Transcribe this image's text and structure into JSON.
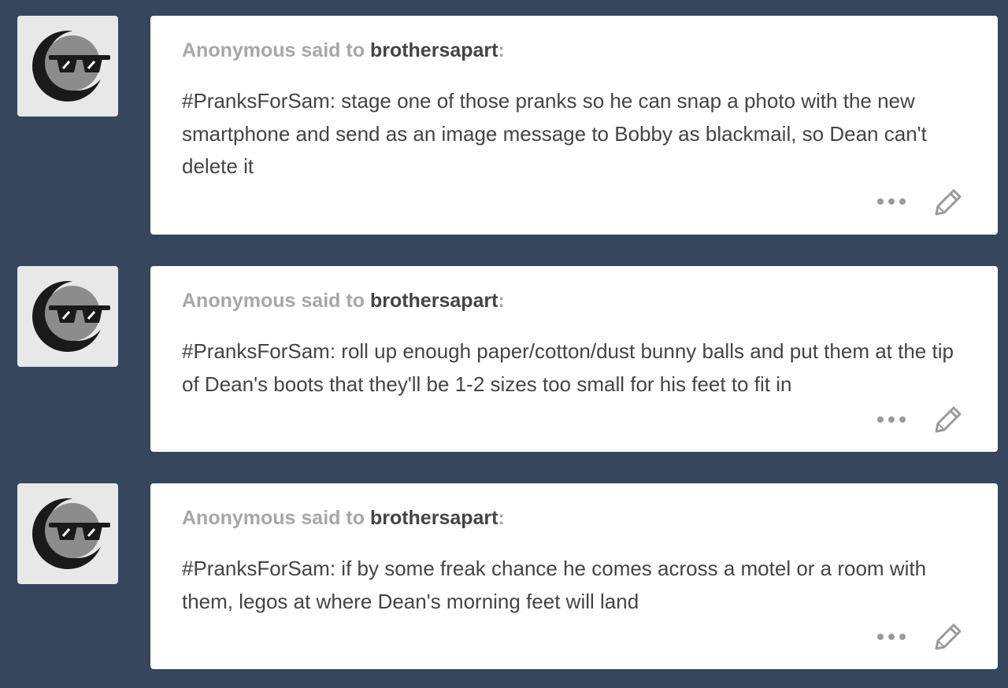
{
  "posts": [
    {
      "asker": "Anonymous",
      "said_to": "said to",
      "blog": "brothersapart",
      "colon": ":",
      "question": "#PranksForSam: stage one of those pranks so he can snap a photo with the new smartphone and send as an image message to Bobby as blackmail, so Dean can't delete it",
      "avatar_icon": "sunglasses-moon-avatar",
      "actions": [
        "more-icon",
        "edit-icon"
      ]
    },
    {
      "asker": "Anonymous",
      "said_to": "said to",
      "blog": "brothersapart",
      "colon": ":",
      "question": "#PranksForSam: roll up enough paper/cotton/dust bunny balls and put them at the tip of Dean's boots that they'll be 1-2 sizes too small for his feet to fit in",
      "avatar_icon": "sunglasses-moon-avatar",
      "actions": [
        "more-icon",
        "edit-icon"
      ]
    },
    {
      "asker": "Anonymous",
      "said_to": "said to",
      "blog": "brothersapart",
      "colon": ":",
      "question": "#PranksForSam: if by some freak chance he comes across a motel or a room with them, legos at where Dean's morning feet will land",
      "avatar_icon": "sunglasses-moon-avatar",
      "actions": [
        "more-icon",
        "edit-icon"
      ]
    }
  ],
  "colors": {
    "background": "#36465d",
    "card": "#ffffff",
    "asker_text": "#a7a7a7",
    "body_text": "#444444",
    "icon_gray": "#9a9a9a"
  }
}
